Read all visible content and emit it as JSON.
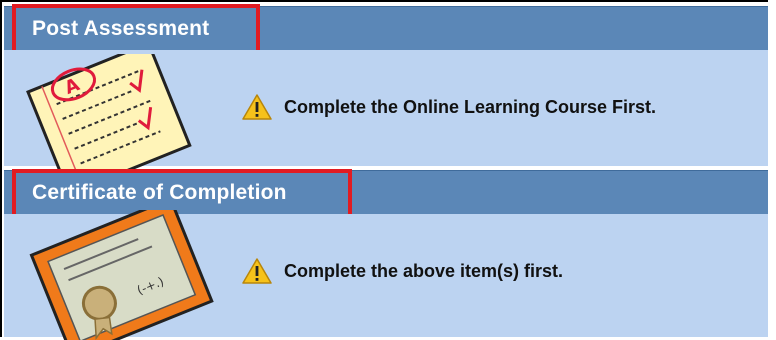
{
  "sections": [
    {
      "title": "Post Assessment",
      "message": "Complete the Online Learning Course First.",
      "illustration_icon": "graded-test-icon",
      "status_icon": "warning-icon"
    },
    {
      "title": "Certificate of Completion",
      "message": "Complete the above item(s) first.",
      "illustration_icon": "certificate-icon",
      "status_icon": "warning-icon"
    }
  ],
  "colors": {
    "header_bg": "#5b87b7",
    "body_bg": "#bcd3f1",
    "highlight_border": "#e11b22",
    "warning_yellow": "#f6c21b"
  }
}
